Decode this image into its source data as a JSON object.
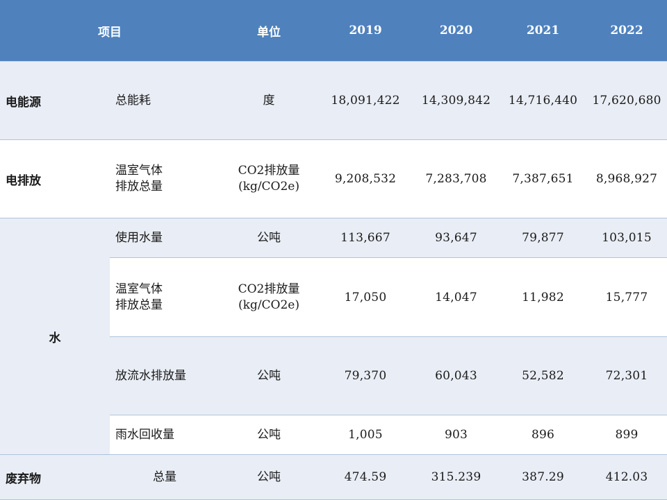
{
  "header": {
    "item": "项目",
    "unit": "单位",
    "years": [
      "2019",
      "2020",
      "2021",
      "2022"
    ]
  },
  "rows": [
    {
      "category": "电能源",
      "name": "总能耗",
      "unit": "度",
      "values": [
        "18,091,422",
        "14,309,842",
        "14,716,440",
        "17,620,680"
      ]
    },
    {
      "category": "电排放",
      "name_lines": [
        "温室气体",
        "排放总量"
      ],
      "unit_lines": [
        "CO2排放量",
        "(kg/CO2e)"
      ],
      "values": [
        "9,208,532",
        "7,283,708",
        "7,387,651",
        "8,968,927"
      ]
    },
    {
      "category": "水",
      "name": "使用水量",
      "unit": "公吨",
      "values": [
        "113,667",
        "93,647",
        "79,877",
        "103,015"
      ]
    },
    {
      "name_lines": [
        "温室气体",
        "排放总量"
      ],
      "unit_lines": [
        "CO2排放量",
        "(kg/CO2e)"
      ],
      "values": [
        "17,050",
        "14,047",
        "11,982",
        "15,777"
      ]
    },
    {
      "name": "放流水排放量",
      "unit": "公吨",
      "values": [
        "79,370",
        "60,043",
        "52,582",
        "72,301"
      ]
    },
    {
      "name": "雨水回收量",
      "unit": "公吨",
      "values": [
        "1,005",
        "903",
        "896",
        "899"
      ]
    },
    {
      "category": "废弃物",
      "name": "总量",
      "unit": "公吨",
      "values": [
        "474.59",
        "315.239",
        "387.29",
        "412.03"
      ]
    }
  ],
  "colors": {
    "header_bg": "#4f81bd",
    "row_shade": "#e9edf5",
    "row_white": "#ffffff",
    "grid_line": "#aec3e0"
  }
}
